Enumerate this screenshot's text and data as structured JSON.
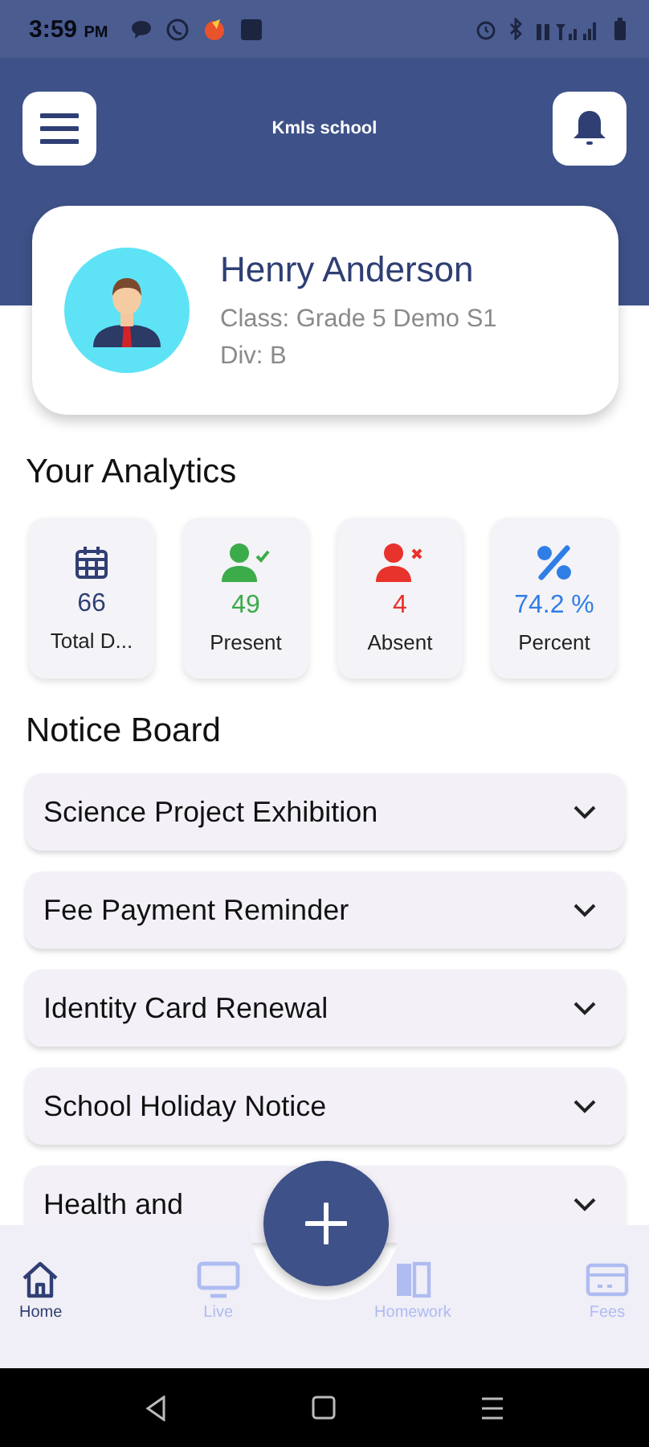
{
  "status_bar": {
    "time": "3:59",
    "ampm": "PM"
  },
  "header": {
    "title": "Kmls school"
  },
  "profile": {
    "name": "Henry Anderson",
    "class_line": "Class: Grade 5 Demo S1",
    "div_line": "Div: B"
  },
  "analytics": {
    "title": "Your Analytics",
    "stats": [
      {
        "kind": "total",
        "value": "66",
        "label": "Total D...",
        "color": "#2f3f74"
      },
      {
        "kind": "present",
        "value": "49",
        "label": "Present",
        "color": "#3cab4a"
      },
      {
        "kind": "absent",
        "value": "4",
        "label": "Absent",
        "color": "#e8322c"
      },
      {
        "kind": "percent",
        "value": "74.2 %",
        "label": "Percent",
        "color": "#2f7ee6"
      }
    ]
  },
  "notice_board": {
    "title": "Notice Board",
    "items": [
      {
        "title": "Science Project Exhibition",
        "expanded": false
      },
      {
        "title": "Fee Payment Reminder",
        "expanded": false
      },
      {
        "title": "Identity Card Renewal",
        "expanded": false
      },
      {
        "title": "School Holiday Notice",
        "expanded": false
      },
      {
        "title": "Health and",
        "expanded": false
      }
    ]
  },
  "bottom_nav": {
    "items": [
      {
        "kind": "home",
        "label": "Home",
        "selected": true
      },
      {
        "kind": "live",
        "label": "Live",
        "selected": false
      },
      {
        "kind": "homework",
        "label": "Homework",
        "selected": false
      },
      {
        "kind": "fees",
        "label": "Fees",
        "selected": false
      }
    ]
  }
}
